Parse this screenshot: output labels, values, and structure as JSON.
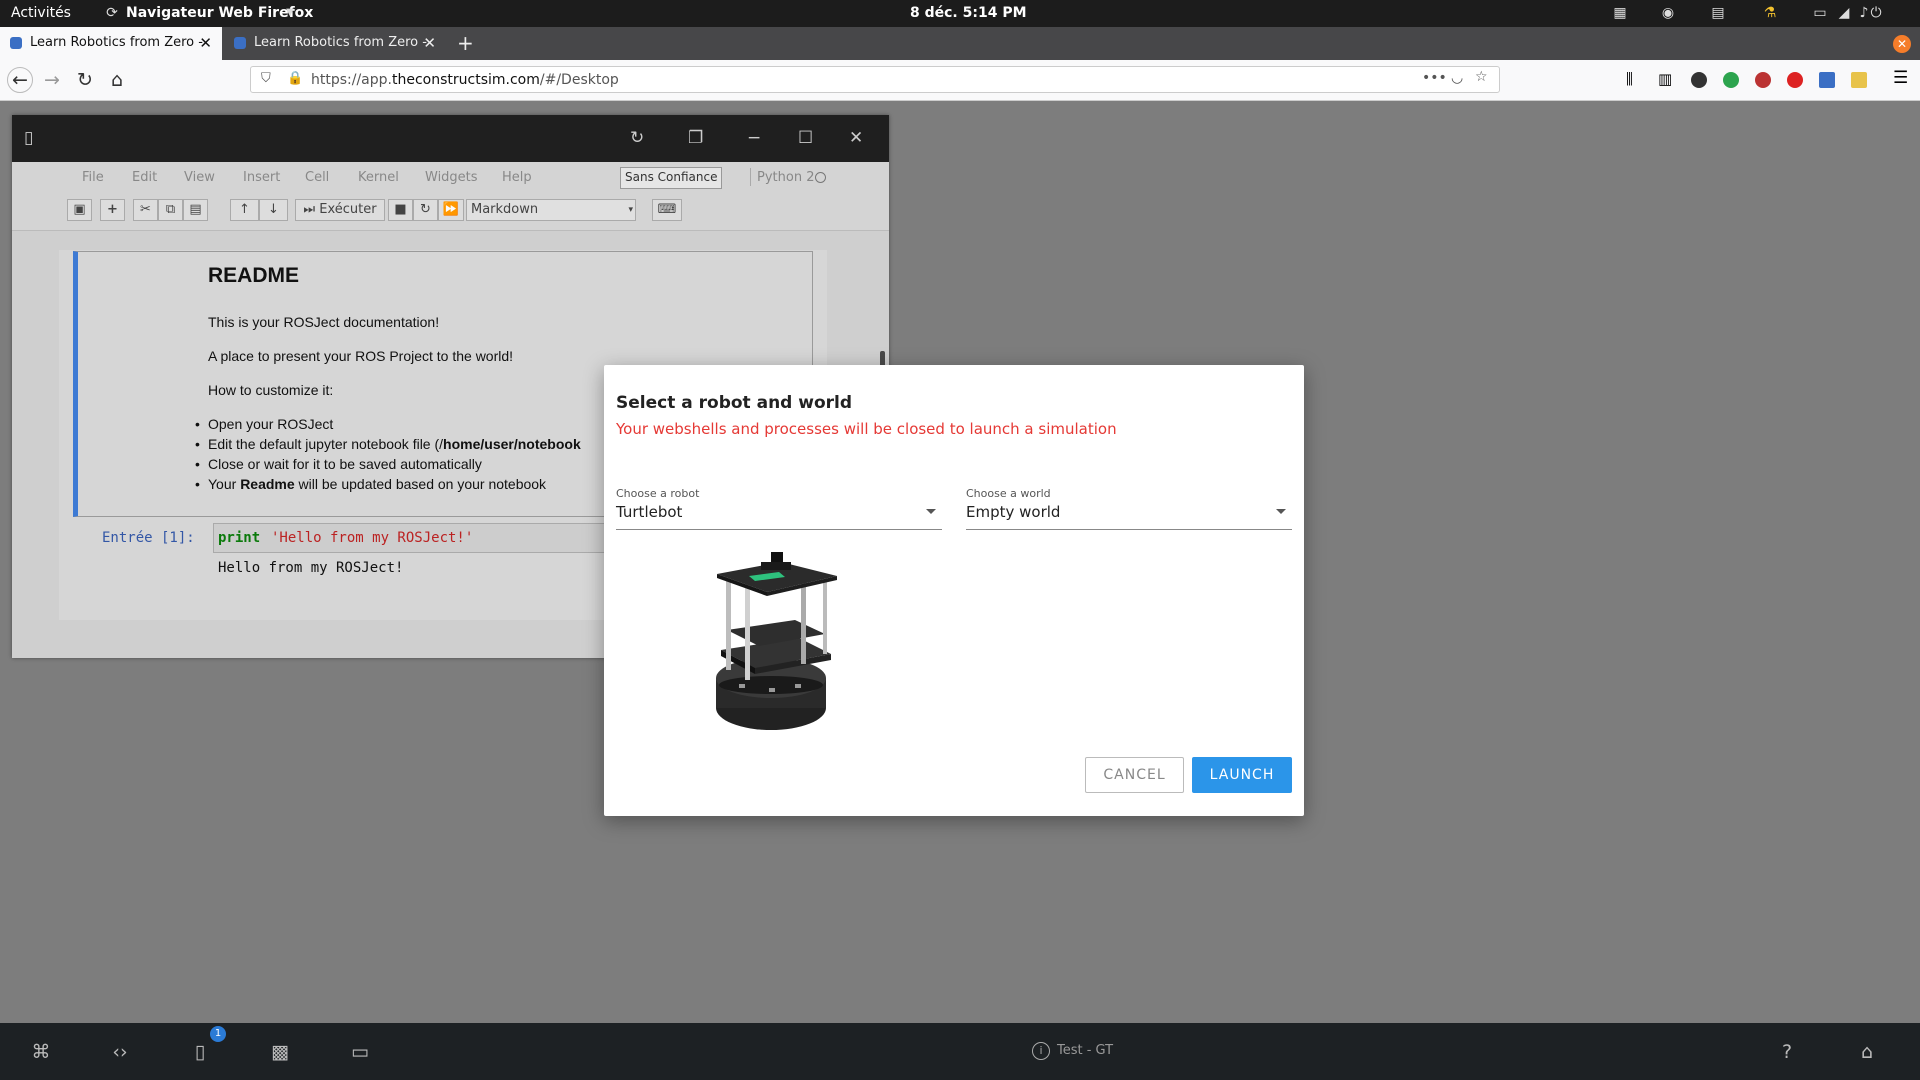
{
  "topbar": {
    "activities": "Activités",
    "app_name": "Navigateur Web Firefox",
    "clock": "8 déc.   5:14 PM"
  },
  "tabs": [
    {
      "label": "Learn Robotics from Zero -"
    },
    {
      "label": "Learn Robotics from Zero -"
    }
  ],
  "url": {
    "prefix": "https://app.",
    "domain": "theconstructsim.com",
    "suffix": "/#/Desktop"
  },
  "jupyter": {
    "menu": [
      "File",
      "Edit",
      "View",
      "Insert",
      "Cell",
      "Kernel",
      "Widgets",
      "Help"
    ],
    "trust_label": "Sans Confiance",
    "kernel_label": "Python 2",
    "run_label": "Exécuter",
    "cell_type": "Markdown",
    "readme": {
      "title": "README",
      "p1": "This is your ROSJect documentation!",
      "p2": "A place to present your ROS Project to the world!",
      "p3": "How to customize it:",
      "items": [
        "Open your ROSJect",
        "Close or wait for it to be saved automatically"
      ],
      "item2_pre": "Edit the default jupyter notebook file (/",
      "item2_bold": "home/user/notebook",
      "item4_pre": "Your ",
      "item4_bold": "Readme",
      "item4_post": " will be updated based on your notebook"
    },
    "code_prompt": "Entrée [1]:",
    "code_kw": "print",
    "code_str": "'Hello from my ROSJect!'",
    "output": "Hello from my ROSJect!"
  },
  "dialog": {
    "title": "Select a robot and world",
    "warning": "Your webshells and processes will be closed to launch a simulation",
    "robot_label": "Choose a robot",
    "robot_value": "Turtlebot",
    "world_label": "Choose a world",
    "world_value": "Empty world",
    "cancel": "CANCEL",
    "launch": "LAUNCH"
  },
  "dock": {
    "notebook_badge": "1",
    "status": "Test - GT"
  }
}
